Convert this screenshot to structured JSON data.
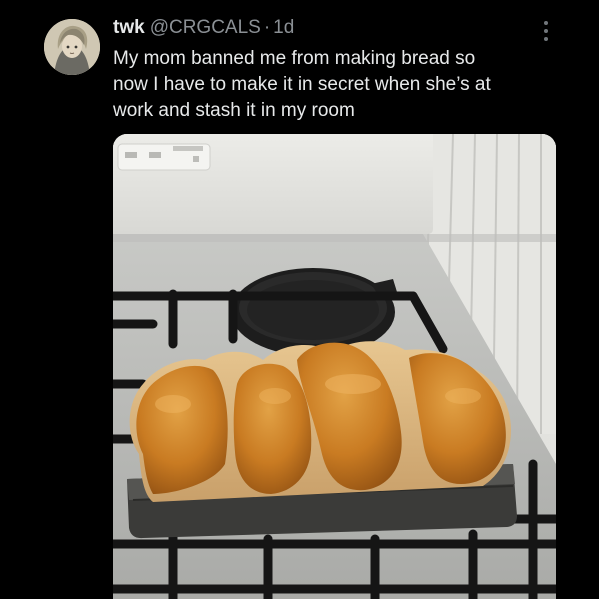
{
  "tweet": {
    "author_name": "twk",
    "handle": "@CRGCALS",
    "separator": "·",
    "timestamp": "1d",
    "text_lines": [
      "My mom banned me from making bread so",
      "now I have to make it in secret when she’s at",
      "work and stash it in my room"
    ],
    "avatar_icon": "anime-character-avatar",
    "more_icon": "more-vertical-icon",
    "media": {
      "subject": "bread-loaf-on-stove-photo"
    }
  },
  "colors": {
    "background": "#000000",
    "primary_text": "#e7e9ea",
    "secondary_text": "#8b9095"
  }
}
